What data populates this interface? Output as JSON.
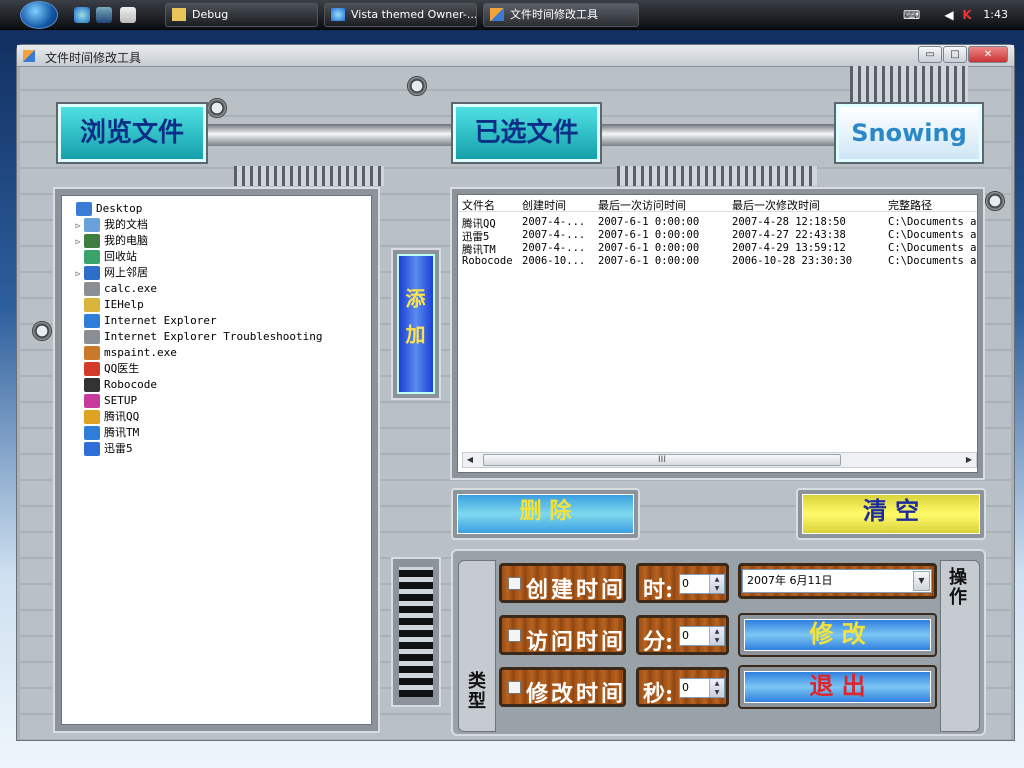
{
  "taskbar": {
    "tasks": [
      {
        "label": "Debug"
      },
      {
        "label": "Vista themed Owner-..."
      },
      {
        "label": "文件时间修改工具"
      }
    ],
    "clock": "1:43"
  },
  "window": {
    "title": "文件时间修改工具",
    "controls": {
      "minimize": "▭",
      "maximize": "□",
      "close": "✕"
    }
  },
  "header": {
    "browse_label": "浏览文件",
    "selected_label": "已选文件",
    "logo_text": "Snowing"
  },
  "tree": [
    {
      "label": "Desktop",
      "expand": "",
      "icon": "desktop-icon",
      "color": "#3a7bd5",
      "depth": 0
    },
    {
      "label": "我的文档",
      "expand": "▷",
      "icon": "documents-icon",
      "color": "#6aa0dc",
      "depth": 1
    },
    {
      "label": "我的电脑",
      "expand": "▷",
      "icon": "computer-icon",
      "color": "#3e7d3e",
      "depth": 1
    },
    {
      "label": "回收站",
      "expand": "",
      "icon": "recycle-bin-icon",
      "color": "#3aa36a",
      "depth": 1
    },
    {
      "label": "网上邻居",
      "expand": "▷",
      "icon": "network-icon",
      "color": "#2d6ec9",
      "depth": 1
    },
    {
      "label": "calc.exe",
      "expand": "",
      "icon": "calculator-icon",
      "color": "#8a8f96",
      "depth": 1
    },
    {
      "label": "IEHelp",
      "expand": "",
      "icon": "help-icon",
      "color": "#d8b53a",
      "depth": 1
    },
    {
      "label": "Internet Explorer",
      "expand": "",
      "icon": "ie-icon",
      "color": "#2f7fd8",
      "depth": 1
    },
    {
      "label": "Internet Explorer Troubleshooting",
      "expand": "",
      "icon": "shortcut-icon",
      "color": "#8a8f96",
      "depth": 1
    },
    {
      "label": "mspaint.exe",
      "expand": "",
      "icon": "paint-icon",
      "color": "#c87a2a",
      "depth": 1
    },
    {
      "label": "QQ医生",
      "expand": "",
      "icon": "qq-doctor-icon",
      "color": "#d43a2a",
      "depth": 1
    },
    {
      "label": "Robocode",
      "expand": "",
      "icon": "robocode-icon",
      "color": "#333333",
      "depth": 1
    },
    {
      "label": "SETUP",
      "expand": "",
      "icon": "setup-icon",
      "color": "#c83a9a",
      "depth": 1
    },
    {
      "label": "腾讯QQ",
      "expand": "",
      "icon": "qq-icon",
      "color": "#e0a020",
      "depth": 1
    },
    {
      "label": "腾讯TM",
      "expand": "",
      "icon": "tm-icon",
      "color": "#2f7fd8",
      "depth": 1
    },
    {
      "label": "迅雷5",
      "expand": "",
      "icon": "thunder-icon",
      "color": "#2f6fd8",
      "depth": 1
    }
  ],
  "add_button": "添加",
  "list": {
    "columns": [
      "文件名",
      "创建时间",
      "最后一次访问时间",
      "最后一次修改时间",
      "完整路径"
    ],
    "rows": [
      [
        "腾讯QQ",
        "2007-4-...",
        "2007-6-1 0:00:00",
        "2007-4-28 12:18:50",
        "C:\\Documents a"
      ],
      [
        "迅雷5",
        "2007-4-...",
        "2007-6-1 0:00:00",
        "2007-4-27 22:43:38",
        "C:\\Documents a"
      ],
      [
        "腾讯TM",
        "2007-4-...",
        "2007-6-1 0:00:00",
        "2007-4-29 13:59:12",
        "C:\\Documents a"
      ],
      [
        "Robocode",
        "2006-10...",
        "2007-6-1 0:00:00",
        "2006-10-28 23:30:30",
        "C:\\Documents a"
      ]
    ],
    "scroll_grip": "III"
  },
  "actions": {
    "delete_label": "删 除",
    "clear_label": "清 空"
  },
  "ops": {
    "type_tab": "类型",
    "op_tab": "操作",
    "create_time": "创建时间",
    "access_time": "访问时间",
    "modify_time": "修改时间",
    "hour_label": "时:",
    "minute_label": "分:",
    "second_label": "秒:",
    "hour_value": "0",
    "minute_value": "0",
    "second_value": "0",
    "date_value": "2007年  6月11日",
    "modify_button": "修 改",
    "exit_button": "退 出"
  }
}
